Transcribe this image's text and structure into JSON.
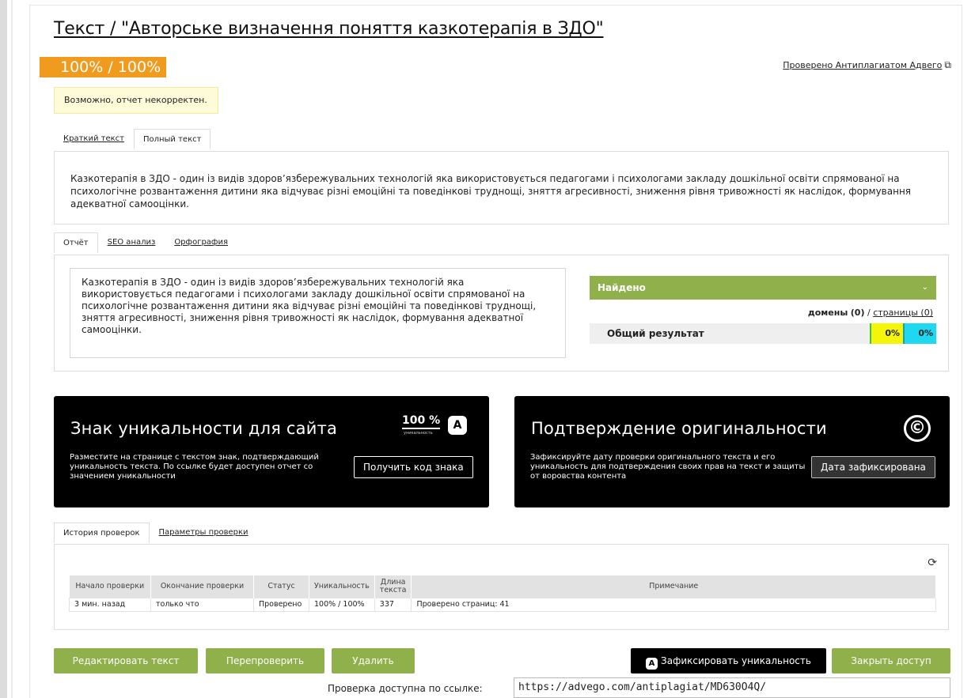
{
  "page_title": "Текст / \"Авторське визначення поняття казкотерапія в ЗДО\"",
  "score_badge": "100% / 100%",
  "checked_by": "Проверено Антиплагиатом Адвего",
  "warning": "Возможно, отчет некорректен.",
  "text_tabs": [
    "Краткий текст",
    "Полный текст"
  ],
  "full_text": "Казкотерапія в ЗДО - один із видів здоров’язбережувальних технологій яка використовується педагогами і психологами закладу дошкільної освіти спрямованої на психологічне розвантаження дитини яка відчуває різні емоційні та поведінкові труднощі, зняття агресивності, зниження рівня тривожності як наслідок, формування адекватної самооцінки.",
  "report_tabs": [
    "Отчёт",
    "SEO анализ",
    "Орфография"
  ],
  "report_text": "Казкотерапія в ЗДО - один із видів здоров’язбережувальних технологій яка використовується педагогами і психологами закладу дошкільної освіти спрямованої на психологічне розвантаження дитини яка відчуває різні емоційні та поведінкові труднощі, зняття агресивності, зниження рівня тривожності як наслідок, формування адекватної самооцінки.",
  "found": {
    "title": "Найдено",
    "domains_label": "домены",
    "domains_count": "(0)",
    "pages_label": "страницы (0)",
    "separator": "/",
    "result_label": "Общий результат",
    "result_a": "0%",
    "result_b": "0%"
  },
  "promo_sign": {
    "title": "Знак уникальности для сайта",
    "text": "Разместите на странице с текстом знак, подтверждающий уникальность текста. По ссылке будет доступен отчет со значением уникальности",
    "button": "Получить код знака",
    "badge_pct": "100 %",
    "badge_sub": "уникальность",
    "badge_letter": "A"
  },
  "promo_original": {
    "title": "Подтверждение оригинальности",
    "text": "Зафиксируйте дату проверки оригинального текста и его уникальность для подтверждения своих прав на текст и защиты от воровства контента",
    "button": "Дата зафиксирована",
    "icon": "©"
  },
  "history_tabs": [
    "История проверок",
    "Параметры проверки"
  ],
  "history_table": {
    "headers": [
      "Начало проверки",
      "Окончание проверки",
      "Статус",
      "Уникальность",
      "Длина текста",
      "Примечание"
    ],
    "rows": [
      [
        "3 мин. назад",
        "только что",
        "Проверено",
        "100% / 100%",
        "337",
        "Проверено страниц: 41"
      ]
    ]
  },
  "buttons": {
    "edit": "Редактировать текст",
    "recheck": "Перепроверить",
    "delete": "Удалить",
    "fix": "Зафиксировать уникальность",
    "fix_letter": "A",
    "close_access": "Закрыть доступ"
  },
  "share": {
    "label": "Проверка доступна по ссылке:",
    "url": "https://advego.com/antiplagiat/MD630O4Q/"
  },
  "colors": {
    "accent_green": "#8fb04a",
    "badge_orange": "#f09a1e",
    "warn_bg": "#fefbd9"
  }
}
